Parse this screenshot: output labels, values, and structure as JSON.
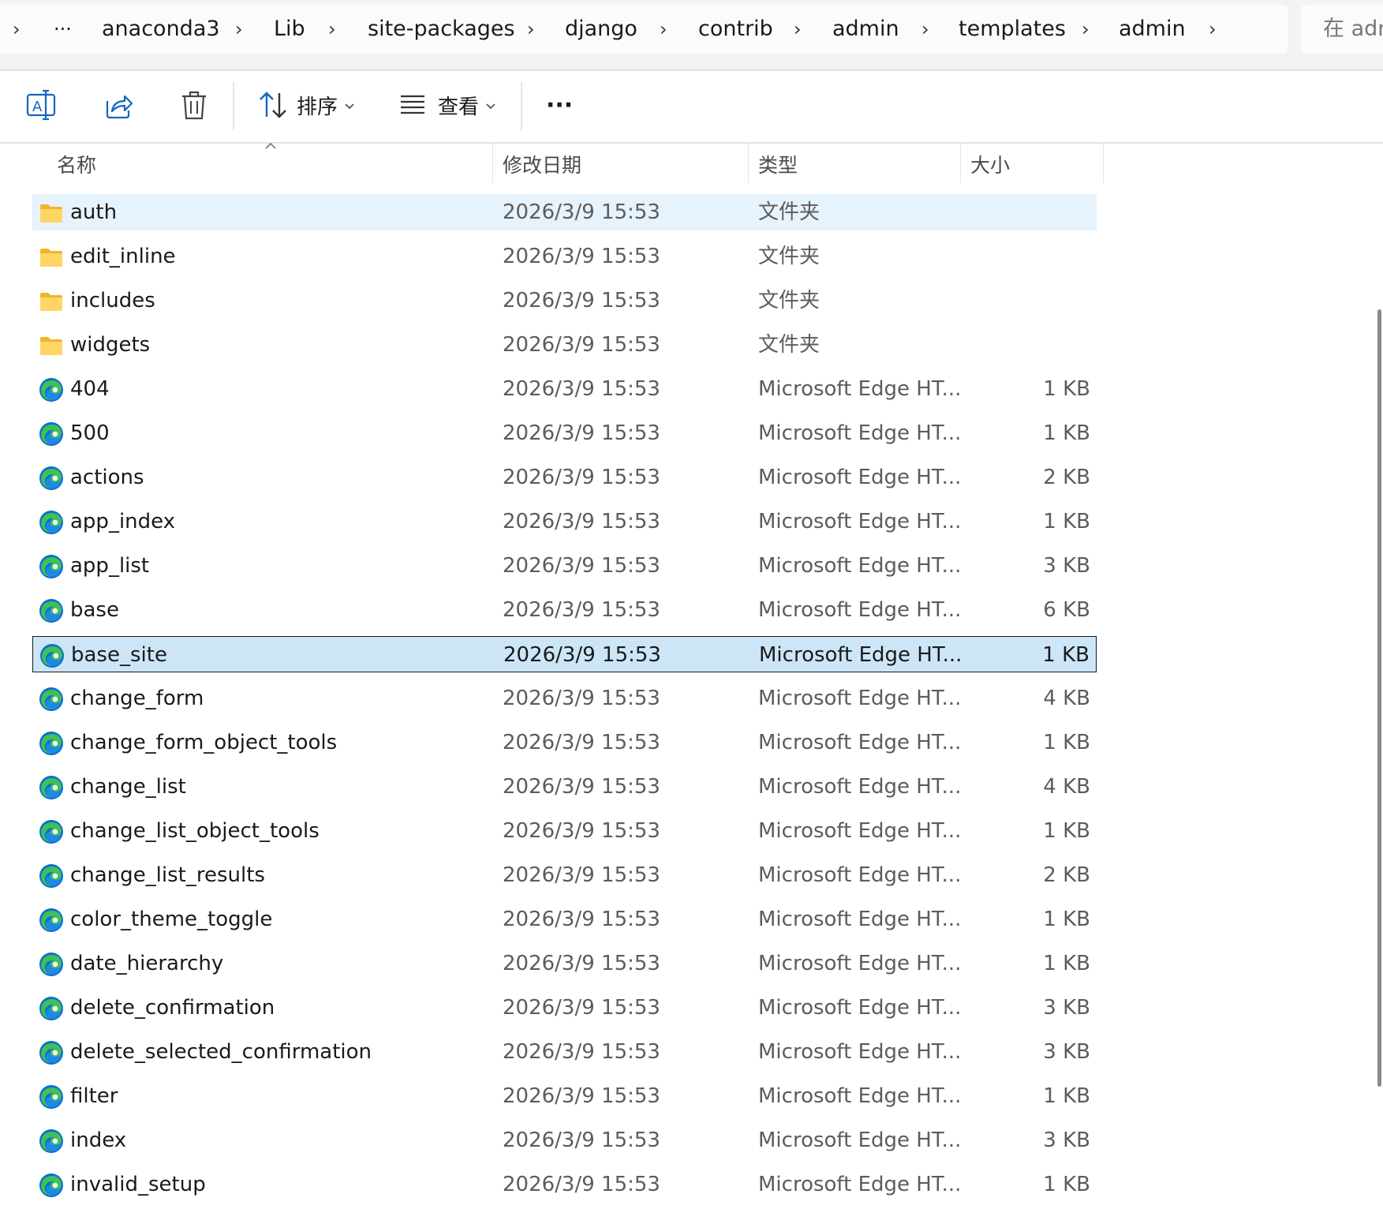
{
  "breadcrumb": {
    "items": [
      "anaconda3",
      "Lib",
      "site-packages",
      "django",
      "contrib",
      "admin",
      "templates",
      "admin"
    ],
    "ellipsis": "···",
    "separator": "›"
  },
  "search": {
    "placeholder": "在 adr"
  },
  "toolbar": {
    "sort_label": "排序",
    "view_label": "查看",
    "more_label": "···"
  },
  "columns": {
    "name": "名称",
    "date": "修改日期",
    "type": "类型",
    "size": "大小"
  },
  "files": [
    {
      "name": "auth",
      "date": "2026/3/9 15:53",
      "type": "文件夹",
      "size": "",
      "kind": "folder"
    },
    {
      "name": "edit_inline",
      "date": "2026/3/9 15:53",
      "type": "文件夹",
      "size": "",
      "kind": "folder"
    },
    {
      "name": "includes",
      "date": "2026/3/9 15:53",
      "type": "文件夹",
      "size": "",
      "kind": "folder"
    },
    {
      "name": "widgets",
      "date": "2026/3/9 15:53",
      "type": "文件夹",
      "size": "",
      "kind": "folder"
    },
    {
      "name": "404",
      "date": "2026/3/9 15:53",
      "type": "Microsoft Edge HT...",
      "size": "1 KB",
      "kind": "edge"
    },
    {
      "name": "500",
      "date": "2026/3/9 15:53",
      "type": "Microsoft Edge HT...",
      "size": "1 KB",
      "kind": "edge"
    },
    {
      "name": "actions",
      "date": "2026/3/9 15:53",
      "type": "Microsoft Edge HT...",
      "size": "2 KB",
      "kind": "edge"
    },
    {
      "name": "app_index",
      "date": "2026/3/9 15:53",
      "type": "Microsoft Edge HT...",
      "size": "1 KB",
      "kind": "edge"
    },
    {
      "name": "app_list",
      "date": "2026/3/9 15:53",
      "type": "Microsoft Edge HT...",
      "size": "3 KB",
      "kind": "edge"
    },
    {
      "name": "base",
      "date": "2026/3/9 15:53",
      "type": "Microsoft Edge HT...",
      "size": "6 KB",
      "kind": "edge"
    },
    {
      "name": "base_site",
      "date": "2026/3/9 15:53",
      "type": "Microsoft Edge HT...",
      "size": "1 KB",
      "kind": "edge"
    },
    {
      "name": "change_form",
      "date": "2026/3/9 15:53",
      "type": "Microsoft Edge HT...",
      "size": "4 KB",
      "kind": "edge"
    },
    {
      "name": "change_form_object_tools",
      "date": "2026/3/9 15:53",
      "type": "Microsoft Edge HT...",
      "size": "1 KB",
      "kind": "edge"
    },
    {
      "name": "change_list",
      "date": "2026/3/9 15:53",
      "type": "Microsoft Edge HT...",
      "size": "4 KB",
      "kind": "edge"
    },
    {
      "name": "change_list_object_tools",
      "date": "2026/3/9 15:53",
      "type": "Microsoft Edge HT...",
      "size": "1 KB",
      "kind": "edge"
    },
    {
      "name": "change_list_results",
      "date": "2026/3/9 15:53",
      "type": "Microsoft Edge HT...",
      "size": "2 KB",
      "kind": "edge"
    },
    {
      "name": "color_theme_toggle",
      "date": "2026/3/9 15:53",
      "type": "Microsoft Edge HT...",
      "size": "1 KB",
      "kind": "edge"
    },
    {
      "name": "date_hierarchy",
      "date": "2026/3/9 15:53",
      "type": "Microsoft Edge HT...",
      "size": "1 KB",
      "kind": "edge"
    },
    {
      "name": "delete_confirmation",
      "date": "2026/3/9 15:53",
      "type": "Microsoft Edge HT...",
      "size": "3 KB",
      "kind": "edge"
    },
    {
      "name": "delete_selected_confirmation",
      "date": "2026/3/9 15:53",
      "type": "Microsoft Edge HT...",
      "size": "3 KB",
      "kind": "edge"
    },
    {
      "name": "filter",
      "date": "2026/3/9 15:53",
      "type": "Microsoft Edge HT...",
      "size": "1 KB",
      "kind": "edge"
    },
    {
      "name": "index",
      "date": "2026/3/9 15:53",
      "type": "Microsoft Edge HT...",
      "size": "3 KB",
      "kind": "edge"
    },
    {
      "name": "invalid_setup",
      "date": "2026/3/9 15:53",
      "type": "Microsoft Edge HT...",
      "size": "1 KB",
      "kind": "edge"
    }
  ],
  "hover_row": 0,
  "selected_row": 10,
  "colors": {
    "hover": "#e6f2fc",
    "selected": "#cde6f7",
    "folder": "#f7c744",
    "edge_blue": "#0c6fd0",
    "edge_green": "#40c057"
  }
}
